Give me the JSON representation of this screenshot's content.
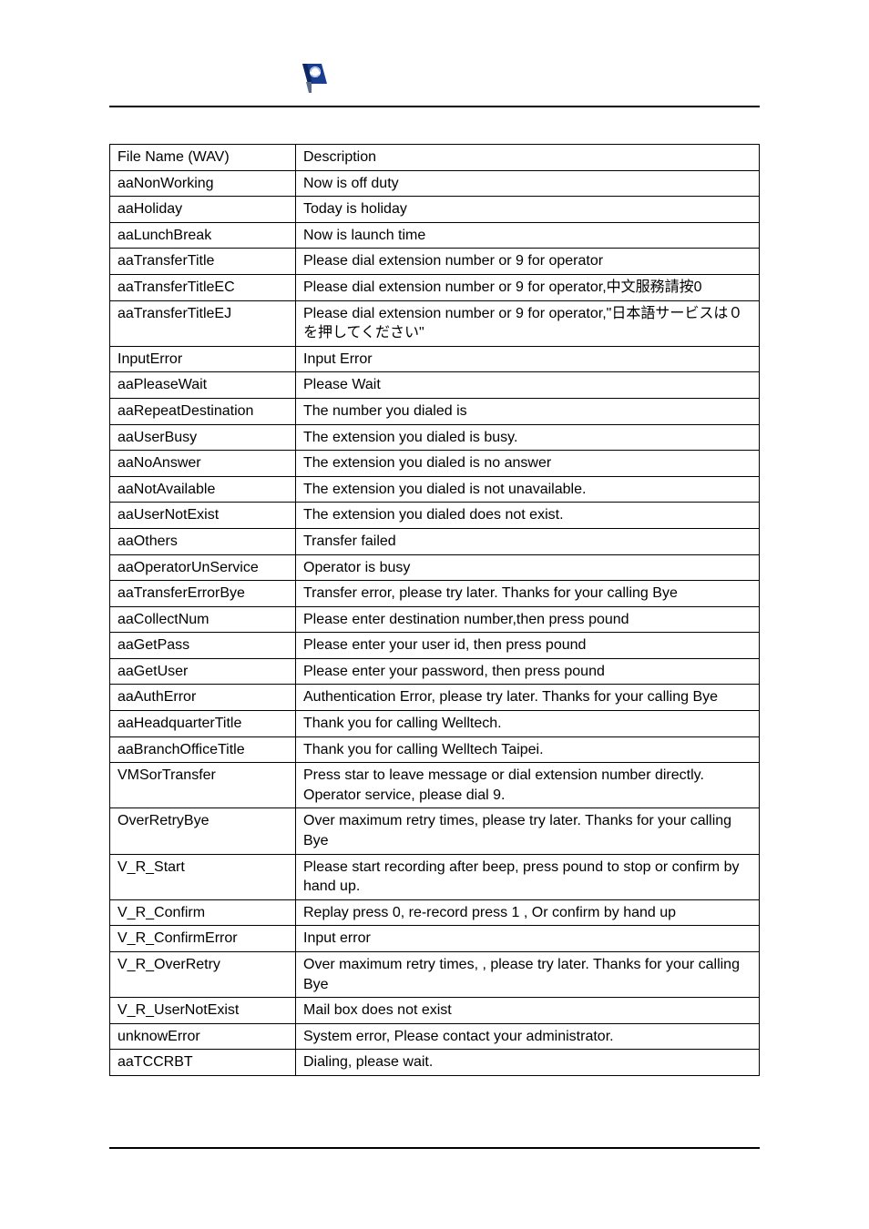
{
  "header": {
    "logo_alt": "logo-icon"
  },
  "table": {
    "rows": [
      {
        "file": "File Name (WAV)",
        "desc": "Description"
      },
      {
        "file": "aaNonWorking",
        "desc": "Now is off duty"
      },
      {
        "file": "aaHoliday",
        "desc": "Today is holiday"
      },
      {
        "file": "aaLunchBreak",
        "desc": "Now is launch time"
      },
      {
        "file": "aaTransferTitle",
        "desc": "Please dial extension number or 9 for operator"
      },
      {
        "file": "aaTransferTitleEC",
        "desc": "Please dial extension number or 9 for operator,中文服務請按0"
      },
      {
        "file": "aaTransferTitleEJ",
        "desc": "Please dial extension number or 9 for operator,\"日本語サービスは０を押してください\""
      },
      {
        "file": "InputError",
        "desc": "Input Error"
      },
      {
        "file": "aaPleaseWait",
        "desc": "Please Wait"
      },
      {
        "file": "aaRepeatDestination",
        "desc": "The number you dialed is"
      },
      {
        "file": "aaUserBusy",
        "desc": "The extension you dialed is busy."
      },
      {
        "file": "aaNoAnswer",
        "desc": "The extension you dialed is no answer"
      },
      {
        "file": "aaNotAvailable",
        "desc": "The extension you dialed is not unavailable."
      },
      {
        "file": "aaUserNotExist",
        "desc": "The extension you dialed does not exist."
      },
      {
        "file": "aaOthers",
        "desc": "Transfer failed"
      },
      {
        "file": "aaOperatorUnService",
        "desc": "Operator is busy"
      },
      {
        "file": "aaTransferErrorBye",
        "desc": "Transfer error, please try later. Thanks for your calling Bye"
      },
      {
        "file": "aaCollectNum",
        "desc": "Please enter destination number,then press pound"
      },
      {
        "file": "aaGetPass",
        "desc": "Please enter your user id, then press pound"
      },
      {
        "file": "aaGetUser",
        "desc": "Please enter your password, then press pound"
      },
      {
        "file": "aaAuthError",
        "desc": "Authentication Error, please try later. Thanks for your calling Bye"
      },
      {
        "file": "aaHeadquarterTitle",
        "desc": "Thank you for calling Welltech."
      },
      {
        "file": "aaBranchOfficeTitle",
        "desc": "Thank you for calling Welltech Taipei."
      },
      {
        "file": "VMSorTransfer",
        "desc": "Press star to leave message or dial extension number directly. Operator service, please dial 9."
      },
      {
        "file": "OverRetryBye",
        "desc": "Over maximum retry times, please try later. Thanks for your calling Bye"
      },
      {
        "file": "V_R_Start",
        "desc": "Please start recording after beep, press pound to stop or confirm by hand up."
      },
      {
        "file": "V_R_Confirm",
        "desc": "Replay press 0, re-record press 1 , Or confirm by hand up"
      },
      {
        "file": "V_R_ConfirmError",
        "desc": "Input error"
      },
      {
        "file": "V_R_OverRetry",
        "desc": "Over maximum retry times, , please try later. Thanks for your calling Bye"
      },
      {
        "file": "V_R_UserNotExist",
        "desc": "Mail box does not exist"
      },
      {
        "file": "unknowError",
        "desc": "System error, Please contact your administrator."
      },
      {
        "file": "aaTCCRBT",
        "desc": "Dialing, please wait."
      }
    ]
  }
}
